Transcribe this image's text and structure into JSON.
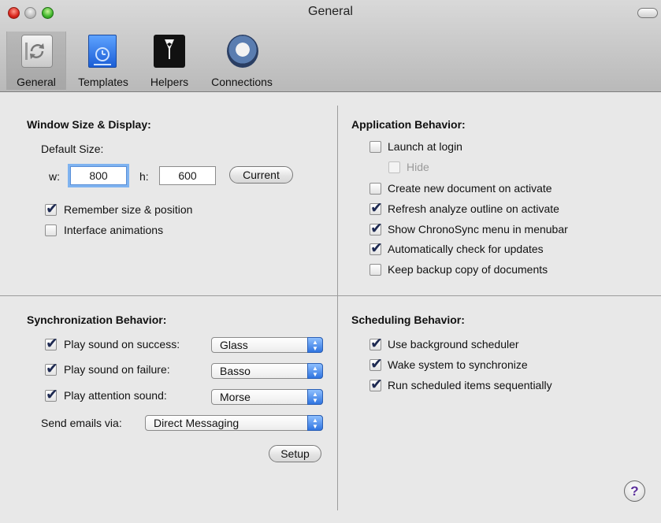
{
  "window": {
    "title": "General"
  },
  "toolbar": {
    "items": [
      {
        "label": "General",
        "icon": "general-prefs-icon"
      },
      {
        "label": "Templates",
        "icon": "templates-icon"
      },
      {
        "label": "Helpers",
        "icon": "helpers-icon"
      },
      {
        "label": "Connections",
        "icon": "connections-icon"
      }
    ]
  },
  "window_size": {
    "header": "Window Size & Display:",
    "default_size_label": "Default Size:",
    "w_label": "w:",
    "w_value": "800",
    "h_label": "h:",
    "h_value": "600",
    "current_button": "Current",
    "options": [
      {
        "label": "Remember size & position",
        "checked": true
      },
      {
        "label": "Interface animations",
        "checked": false
      }
    ]
  },
  "app_behavior": {
    "header": "Application Behavior:",
    "options": [
      {
        "label": "Launch at login",
        "checked": false
      },
      {
        "label": "Hide",
        "checked": false,
        "disabled": true
      },
      {
        "label": "Create new document on activate",
        "checked": false
      },
      {
        "label": "Refresh analyze outline on activate",
        "checked": true
      },
      {
        "label": "Show ChronoSync menu in menubar",
        "checked": true
      },
      {
        "label": "Automatically check for updates",
        "checked": true
      },
      {
        "label": "Keep backup copy of documents",
        "checked": false
      }
    ]
  },
  "sync_behavior": {
    "header": "Synchronization Behavior:",
    "sounds": [
      {
        "label": "Play sound on success:",
        "checked": true,
        "value": "Glass"
      },
      {
        "label": "Play sound on failure:",
        "checked": true,
        "value": "Basso"
      },
      {
        "label": "Play attention sound:",
        "checked": true,
        "value": "Morse"
      }
    ],
    "email_label": "Send emails via:",
    "email_value": "Direct Messaging",
    "setup_button": "Setup"
  },
  "scheduling": {
    "header": "Scheduling Behavior:",
    "options": [
      {
        "label": "Use background scheduler",
        "checked": true
      },
      {
        "label": "Wake system to synchronize",
        "checked": true
      },
      {
        "label": "Run scheduled items sequentially",
        "checked": true
      }
    ]
  },
  "help": {
    "label": "?"
  }
}
